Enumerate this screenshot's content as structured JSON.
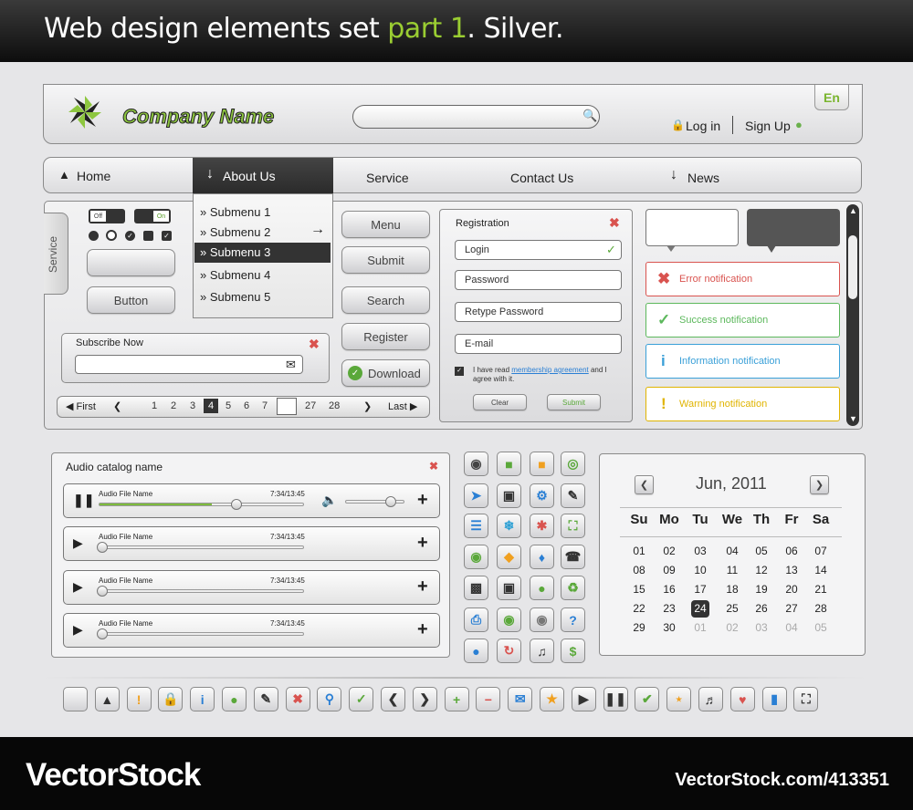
{
  "title": {
    "part_a": "Web design elements set ",
    "part_b": "part 1",
    "part_c": ". Silver."
  },
  "header": {
    "company_name": "Company Name",
    "lang": "En",
    "login": "Log in",
    "signup": "Sign Up",
    "search_placeholder": ""
  },
  "nav": {
    "items": [
      "Home",
      "About Us",
      "Service",
      "Contact Us",
      "News"
    ],
    "submenu": [
      "Submenu 1",
      "Submenu 2",
      "Submenu 3",
      "Submenu 4",
      "Submenu 5"
    ],
    "active_submenu": "Submenu 3"
  },
  "controls": {
    "side_tab": "Service",
    "toggle_off": "Off",
    "toggle_on": "On",
    "button": "Button",
    "buttons": [
      "Menu",
      "Submit",
      "Search",
      "Register",
      "Download"
    ],
    "subscribe": "Subscribe Now"
  },
  "pagination": {
    "first": "First",
    "last": "Last",
    "pages": [
      "1",
      "2",
      "3",
      "4",
      "5",
      "6",
      "7",
      "27",
      "28"
    ],
    "current": "4"
  },
  "registration": {
    "title": "Registration",
    "fields": [
      "Login",
      "Password",
      "Retype Password",
      "E-mail"
    ],
    "agree_text": "I have read",
    "agree_link": "membership agreement",
    "agree_rest": "and I agree with it.",
    "clear": "Clear",
    "submit": "Submit"
  },
  "notifications": [
    {
      "text": "Error notification",
      "color": "#d9534f",
      "icon": "x-icon"
    },
    {
      "text": "Success notification",
      "color": "#5cb85c",
      "icon": "check-icon"
    },
    {
      "text": "Information notification",
      "color": "#3aa0d8",
      "icon": "info-icon"
    },
    {
      "text": "Warning notification",
      "color": "#e0b400",
      "icon": "warning-icon"
    }
  ],
  "audio": {
    "catalog_name": "Audio catalog name",
    "tracks": [
      {
        "name": "Audio File Name",
        "time": "7:34/13:45",
        "progress": 0.55,
        "playing": true
      },
      {
        "name": "Audio File Name",
        "time": "7:34/13:45",
        "progress": 0,
        "playing": false
      },
      {
        "name": "Audio File Name",
        "time": "7:34/13:45",
        "progress": 0,
        "playing": false
      },
      {
        "name": "Audio File Name",
        "time": "7:34/13:45",
        "progress": 0,
        "playing": false
      }
    ],
    "volume": 0.8
  },
  "calendar": {
    "month": "Jun, 2011",
    "weekdays": [
      "Su",
      "Mo",
      "Tu",
      "We",
      "Th",
      "Fr",
      "Sa"
    ],
    "weeks": [
      [
        "01",
        "02",
        "03",
        "04",
        "05",
        "06",
        "07"
      ],
      [
        "08",
        "09",
        "10",
        "11",
        "12",
        "13",
        "14"
      ],
      [
        "15",
        "16",
        "17",
        "18",
        "19",
        "20",
        "21"
      ],
      [
        "22",
        "23",
        "24",
        "25",
        "26",
        "27",
        "28"
      ],
      [
        "29",
        "30",
        "01",
        "02",
        "03",
        "04",
        "05"
      ]
    ],
    "selected": "24"
  },
  "icon_grid": [
    "disc-icon",
    "chat-icon",
    "folder-icon",
    "globe-icon",
    "pin-icon",
    "save-icon",
    "gear-icon",
    "microphone-icon",
    "sliders-icon",
    "snowflake-icon",
    "star-burst-icon",
    "cart-icon",
    "camera-icon",
    "shield-icon",
    "tag-icon",
    "phone-icon",
    "trash-icon",
    "video-camera-icon",
    "bulb-icon",
    "recycle-icon",
    "printer-icon",
    "eye-icon",
    "eye-closed-icon",
    "question-icon",
    "gamepad-icon",
    "refresh-icon",
    "music-icon",
    "dollar-icon"
  ],
  "bottom_icons": [
    "blank-icon",
    "home-icon",
    "exclamation-icon",
    "lock-icon",
    "info-icon",
    "user-icon",
    "pencil-icon",
    "close-icon",
    "search-icon",
    "check-icon",
    "chevron-left-icon",
    "chevron-right-icon",
    "plus-icon",
    "minus-icon",
    "mail-icon",
    "star-icon",
    "play-icon",
    "pause-icon",
    "check-circle-icon",
    "rss-icon",
    "volume-icon",
    "heart-icon",
    "bar-chart-icon",
    "fullscreen-icon"
  ],
  "footer": {
    "brand": "VectorStock",
    "url": "VectorStock.com/413351"
  }
}
